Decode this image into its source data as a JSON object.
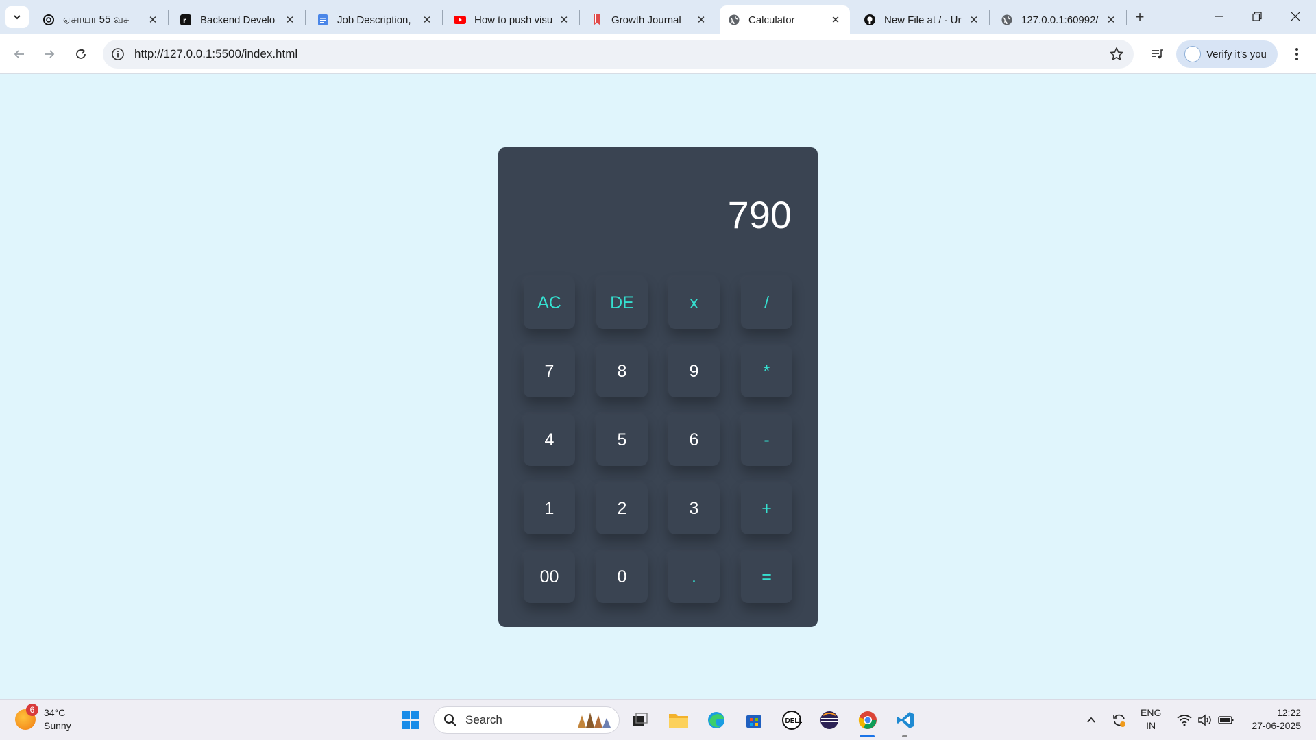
{
  "browser": {
    "tabs": [
      {
        "title": "ஏசாயா 55 வச",
        "icon": "chatgpt-icon"
      },
      {
        "title": "Backend Develo",
        "icon": "r-logo-icon"
      },
      {
        "title": "Job Description,",
        "icon": "google-docs-icon"
      },
      {
        "title": "How to push visu",
        "icon": "youtube-icon"
      },
      {
        "title": "Growth Journal",
        "icon": "bookmark-icon"
      },
      {
        "title": "Calculator",
        "icon": "globe-icon",
        "active": true
      },
      {
        "title": "New File at / · Ur",
        "icon": "github-icon"
      },
      {
        "title": "127.0.0.1:60992/",
        "icon": "globe-icon"
      }
    ],
    "url": "http://127.0.0.1:5500/index.html",
    "profile_label": "Verify it's you"
  },
  "calculator": {
    "display": "790",
    "keys": [
      [
        "AC",
        "DE",
        "x",
        "/"
      ],
      [
        "7",
        "8",
        "9",
        "*"
      ],
      [
        "4",
        "5",
        "6",
        "-"
      ],
      [
        "1",
        "2",
        "3",
        "+"
      ],
      [
        "00",
        "0",
        ".",
        "="
      ]
    ],
    "operator_keys": [
      "AC",
      "DE",
      "x",
      "/",
      "*",
      "-",
      "+",
      ".",
      "="
    ],
    "colors": {
      "panel": "#3a4452",
      "accent": "#35e0d0",
      "digit": "#ffffff",
      "page": "#e0f5fc"
    }
  },
  "taskbar": {
    "weather": {
      "temp": "34°C",
      "condition": "Sunny",
      "badge": "6"
    },
    "search_placeholder": "Search",
    "lang": {
      "line1": "ENG",
      "line2": "IN"
    },
    "clock": {
      "time": "12:22",
      "date": "27-06-2025"
    }
  }
}
